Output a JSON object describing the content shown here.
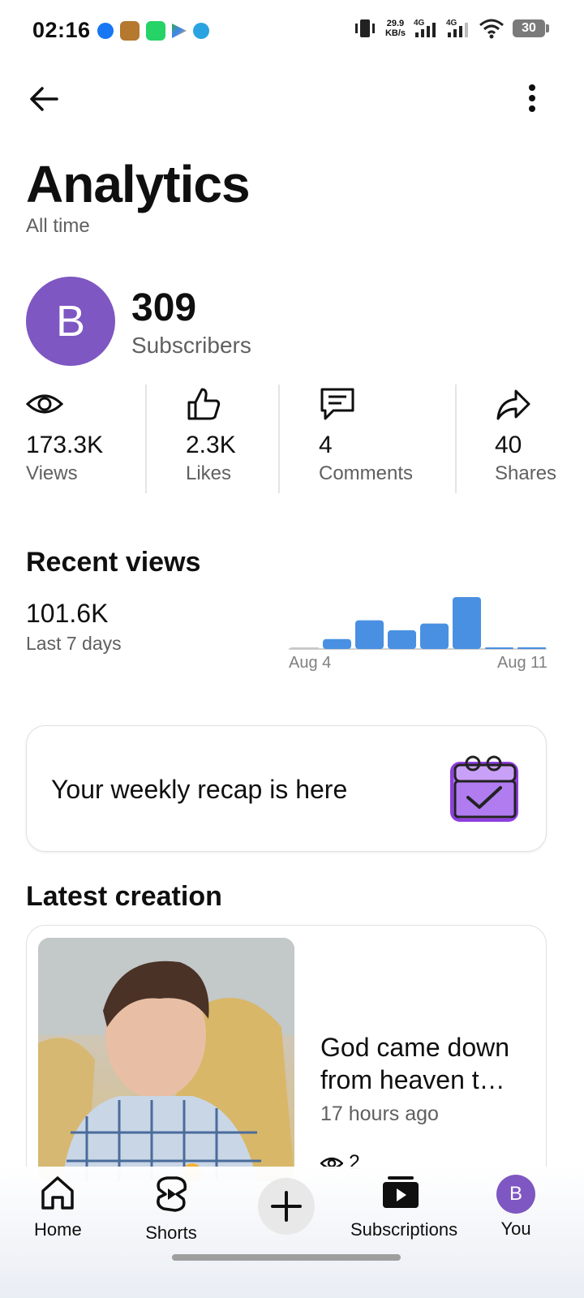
{
  "status_bar": {
    "time": "02:16",
    "net_speed_value": "29.9",
    "net_speed_unit": "KB/s",
    "signal_1": "4G",
    "signal_2": "4G",
    "battery": "30"
  },
  "header": {
    "title": "Analytics",
    "subtitle": "All time"
  },
  "channel": {
    "avatar_letter": "B",
    "avatar_color": "#7e57c2",
    "subscriber_count": "309",
    "subscriber_label": "Subscribers"
  },
  "stats": [
    {
      "icon": "eye-icon",
      "value": "173.3K",
      "label": "Views"
    },
    {
      "icon": "thumbs-up-icon",
      "value": "2.3K",
      "label": "Likes"
    },
    {
      "icon": "comment-icon",
      "value": "4",
      "label": "Comments"
    },
    {
      "icon": "share-icon",
      "value": "40",
      "label": "Shares"
    }
  ],
  "recent_views": {
    "title": "Recent views",
    "value": "101.6K",
    "period": "Last 7 days",
    "axis_start": "Aug 4",
    "axis_end": "Aug 11"
  },
  "chart_data": {
    "type": "bar",
    "title": "",
    "categories": [
      "",
      "",
      "",
      "",
      "",
      "",
      "",
      ""
    ],
    "values": [
      0.5,
      4.5,
      13,
      8.5,
      11.5,
      23.5,
      0.5,
      0.8
    ],
    "x_tick_labels": [
      "Aug 4",
      "Aug 11"
    ],
    "color": "#4a90e2",
    "grid": false
  },
  "recap": {
    "text": "Your weekly recap is here"
  },
  "latest": {
    "title": "Latest creation",
    "video_title": "God came down from heaven t…",
    "time_ago": "17 hours ago",
    "views": "2"
  },
  "bottom_nav": {
    "home": "Home",
    "shorts": "Shorts",
    "subscriptions": "Subscriptions",
    "you": "You",
    "you_avatar_letter": "B"
  }
}
